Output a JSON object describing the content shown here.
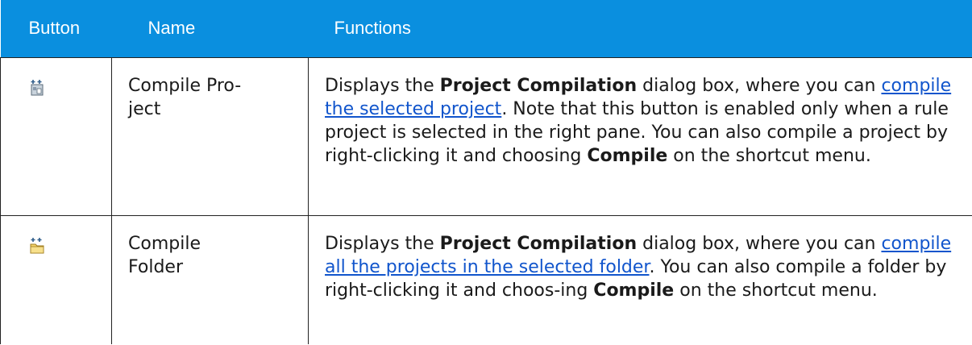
{
  "header": {
    "col_button": "Button",
    "col_name": "Name",
    "col_functions": "Functions"
  },
  "rows": [
    {
      "icon": "compile-project-icon",
      "name_line1": "Compile Pro-",
      "name_line2": "ject",
      "func": {
        "t1": "Displays the ",
        "b1": "Project Compilation",
        "t2": " dialog box, where you can ",
        "link": "compile the selected project",
        "t3": ". Note that this button is enabled only when a rule project is selected in the right pane. You can also compile a project by right-clicking it and choosing ",
        "b2": "Compile",
        "t4": " on the shortcut menu."
      }
    },
    {
      "icon": "compile-folder-icon",
      "name_line1": "Compile",
      "name_line2": "Folder",
      "func": {
        "t1": "Displays the ",
        "b1": "Project Compilation",
        "t2": " dialog box, where you can ",
        "link": "compile all the projects in the selected folder",
        "t3": ". You can also compile a folder by right-clicking it and choos-ing ",
        "b2": "Compile",
        "t4": " on the shortcut menu."
      }
    }
  ],
  "colors": {
    "header_bg": "#0a8fdf",
    "link": "#1155cc"
  }
}
